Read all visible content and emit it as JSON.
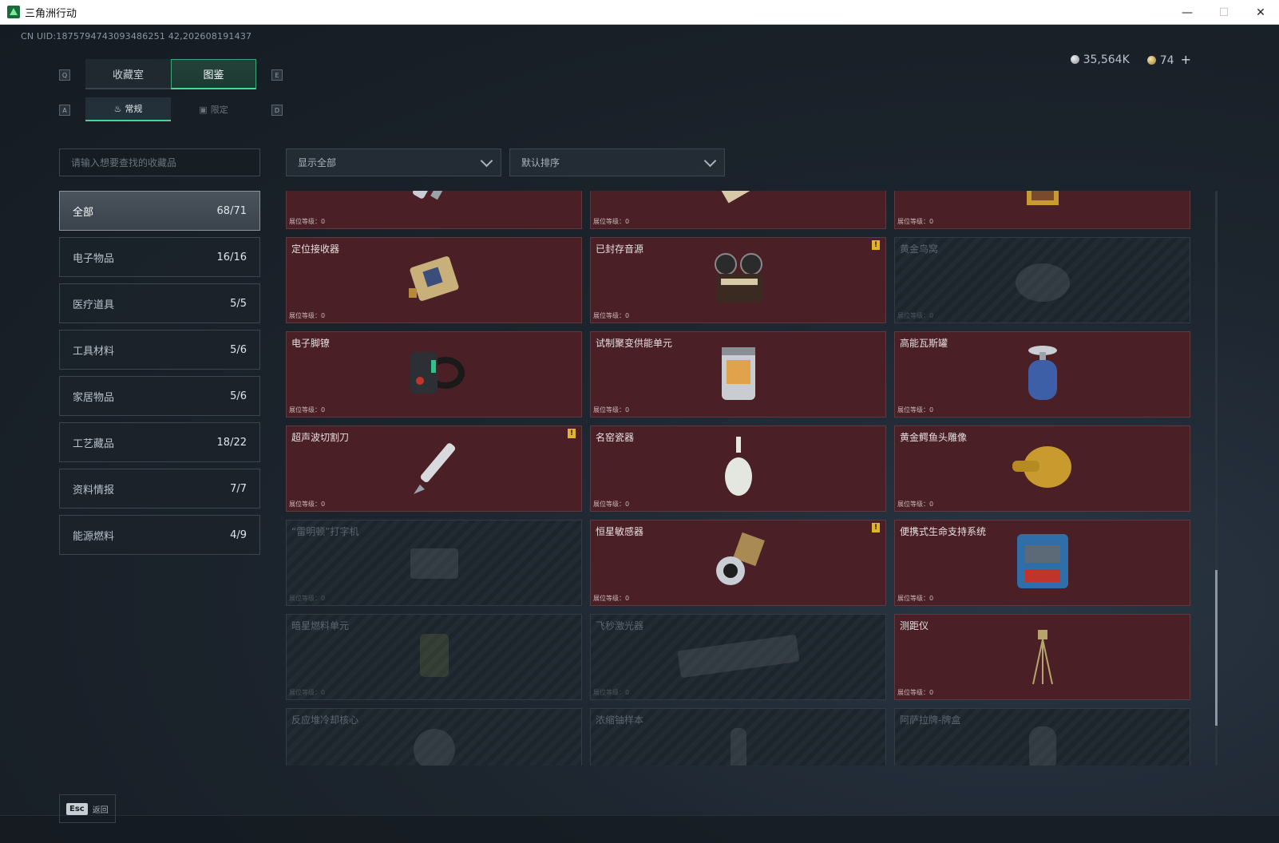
{
  "window": {
    "title": "三角洲行动",
    "minimize": "—",
    "maximize": "☐",
    "close": "✕"
  },
  "uid": "CN UID:1875794743093486251 42,202608191437",
  "currency": {
    "silver": "35,564K",
    "gold": "74",
    "plus": "+"
  },
  "keys": {
    "q": "Q",
    "e": "E",
    "a": "A",
    "d": "D"
  },
  "tabs": [
    {
      "label": "收藏室"
    },
    {
      "label": "图鉴"
    }
  ],
  "subtabs": [
    {
      "label": "常规"
    },
    {
      "label": "限定"
    }
  ],
  "search": {
    "placeholder": "请输入想要查找的收藏品"
  },
  "filters": {
    "show": "显示全部",
    "sort": "默认排序"
  },
  "categories": [
    {
      "label": "全部",
      "count": "68/71"
    },
    {
      "label": "电子物品",
      "count": "16/16"
    },
    {
      "label": "医疗道具",
      "count": "5/5"
    },
    {
      "label": "工具材料",
      "count": "5/6"
    },
    {
      "label": "家居物品",
      "count": "5/6"
    },
    {
      "label": "工艺藏品",
      "count": "18/22"
    },
    {
      "label": "资料情报",
      "count": "7/7"
    },
    {
      "label": "能源燃料",
      "count": "4/9"
    }
  ],
  "level_label": "展位等级：0",
  "items": [
    {
      "name": "",
      "icon": "flashlight-icon"
    },
    {
      "name": "",
      "icon": "painting-scroll-icon"
    },
    {
      "name": "",
      "icon": "framed-painting-icon"
    },
    {
      "name": "定位接收器",
      "icon": "receiver-icon"
    },
    {
      "name": "已封存音源",
      "icon": "reel-recorder-icon"
    },
    {
      "name": "黄金鸟窝",
      "icon": "bird-nest-icon"
    },
    {
      "name": "电子脚镣",
      "icon": "ankle-monitor-icon"
    },
    {
      "name": "试制聚变供能单元",
      "icon": "fusion-unit-icon"
    },
    {
      "name": "高能瓦斯罐",
      "icon": "gas-canister-icon"
    },
    {
      "name": "超声波切割刀",
      "icon": "ultrasonic-cutter-icon"
    },
    {
      "name": "名窑瓷器",
      "icon": "porcelain-vase-icon"
    },
    {
      "name": "黄金鳄鱼头雕像",
      "icon": "gold-croc-head-icon"
    },
    {
      "name": "“雷明顿”打字机",
      "icon": "typewriter-icon"
    },
    {
      "name": "恒星敏感器",
      "icon": "star-sensor-icon"
    },
    {
      "name": "便携式生命支持系统",
      "icon": "life-support-icon"
    },
    {
      "name": "暗星燃料单元",
      "icon": "fuel-cell-icon"
    },
    {
      "name": "飞秒激光器",
      "icon": "laser-icon"
    },
    {
      "name": "测距仪",
      "icon": "rangefinder-tripod-icon"
    },
    {
      "name": "反应堆冷却核心",
      "icon": "reactor-core-icon"
    },
    {
      "name": "浓缩铀样本",
      "icon": "uranium-sample-icon"
    },
    {
      "name": "阿萨拉牌-牌盒",
      "icon": "card-box-icon"
    }
  ],
  "colors": {
    "accent": "#49d58f",
    "owned_card": "#4a1f25",
    "warning": "#e2b32d"
  },
  "footer": {
    "esc_key": "Esc",
    "esc_label": "返回"
  }
}
